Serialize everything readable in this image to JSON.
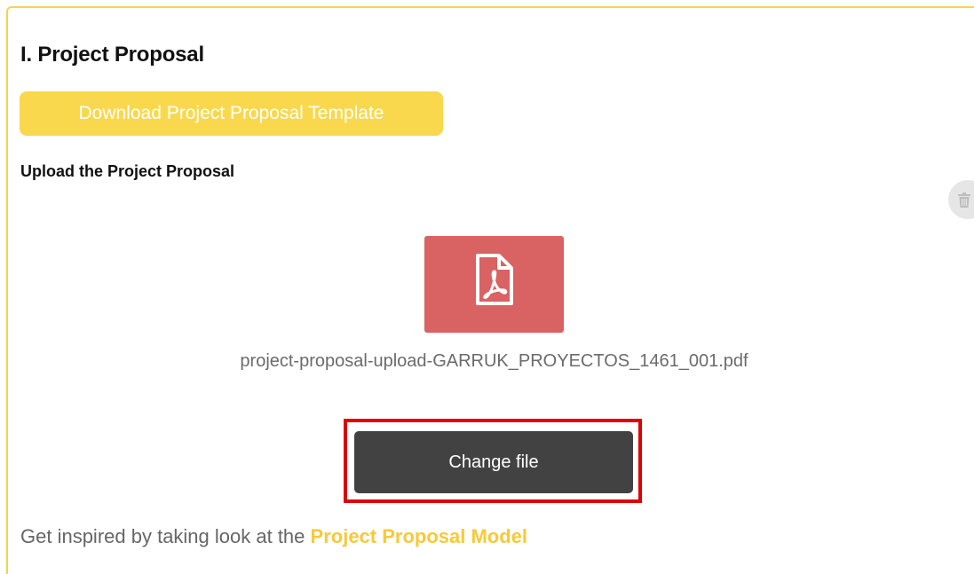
{
  "section": {
    "title": "I. Project Proposal",
    "download_button": "Download Project Proposal Template",
    "upload_label": "Upload the Project Proposal"
  },
  "file": {
    "icon": "pdf-file-icon",
    "name": "project-proposal-upload-GARRUK_PROYECTOS_1461_001.pdf"
  },
  "actions": {
    "change_file": "Change file",
    "delete_icon": "trash-icon"
  },
  "inspire": {
    "prefix": "Get inspired by taking look at the ",
    "link": "Project Proposal Model"
  },
  "colors": {
    "accent_yellow": "#f9d84e",
    "pdf_red": "#d96262",
    "button_dark": "#424242",
    "highlight_red": "#e00000"
  }
}
